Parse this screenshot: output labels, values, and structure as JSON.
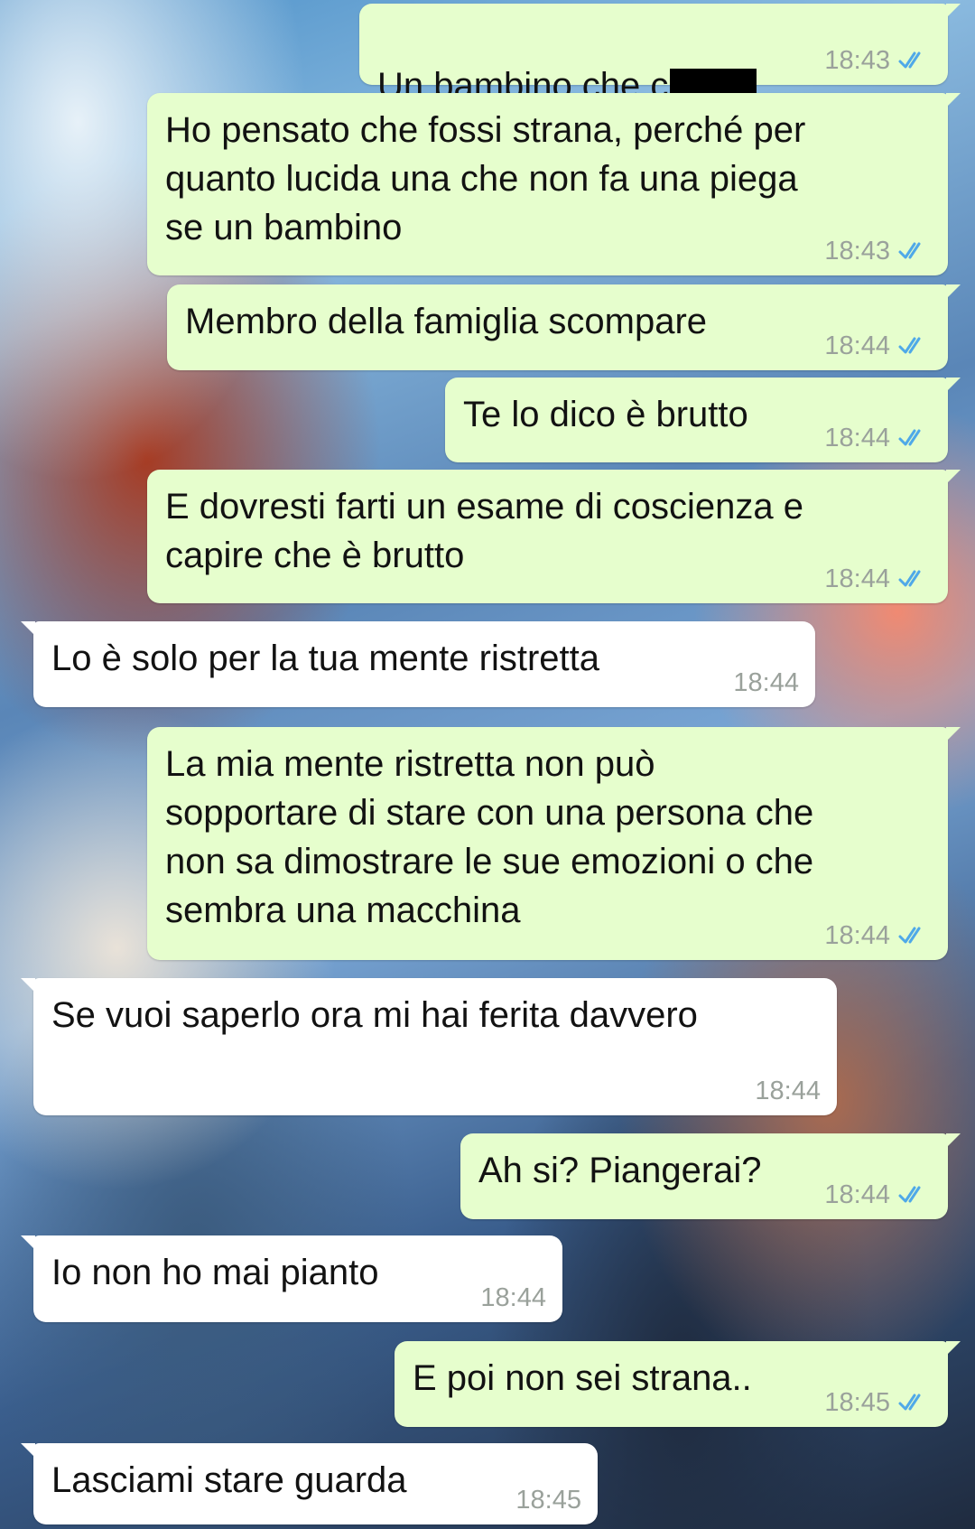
{
  "conversation": {
    "messages": [
      {
        "text": "Un bambino che c",
        "time": "18:43",
        "status_icon": "double-check-icon",
        "redacted_note": ""
      },
      {
        "text": "Ho pensato che fossi strana, perché per\nquanto lucida una che non fa una piega\nse un bambino",
        "time": "18:43",
        "status_icon": "double-check-icon"
      },
      {
        "text": "Membro della famiglia scompare",
        "time": "18:44",
        "status_icon": "double-check-icon"
      },
      {
        "text": "Te lo dico è brutto",
        "time": "18:44",
        "status_icon": "double-check-icon"
      },
      {
        "text": "E dovresti farti un esame di coscienza e\ncapire che è brutto",
        "time": "18:44",
        "status_icon": "double-check-icon"
      },
      {
        "text": "Lo è solo per la tua mente ristretta",
        "time": "18:44"
      },
      {
        "text": "La mia mente ristretta non può\nsopportare di stare con una persona che\nnon sa dimostrare le sue emozioni o che\nsembra una macchina",
        "time": "18:44",
        "status_icon": "double-check-icon"
      },
      {
        "text": "Se vuoi saperlo ora mi hai ferita davvero",
        "time": "18:44"
      },
      {
        "text": "Ah si? Piangerai?",
        "time": "18:44",
        "status_icon": "double-check-icon"
      },
      {
        "text": "Io non ho mai pianto",
        "time": "18:44"
      },
      {
        "text": "E poi non sei strana..",
        "time": "18:45",
        "status_icon": "double-check-icon"
      },
      {
        "text": "Lasciami stare guarda",
        "time": "18:45"
      }
    ]
  },
  "colors": {
    "outgoing_bubble": "#e6fecd",
    "incoming_bubble": "#ffffff",
    "read_check": "#4fa9e8",
    "timestamp": "#9aa19b"
  }
}
